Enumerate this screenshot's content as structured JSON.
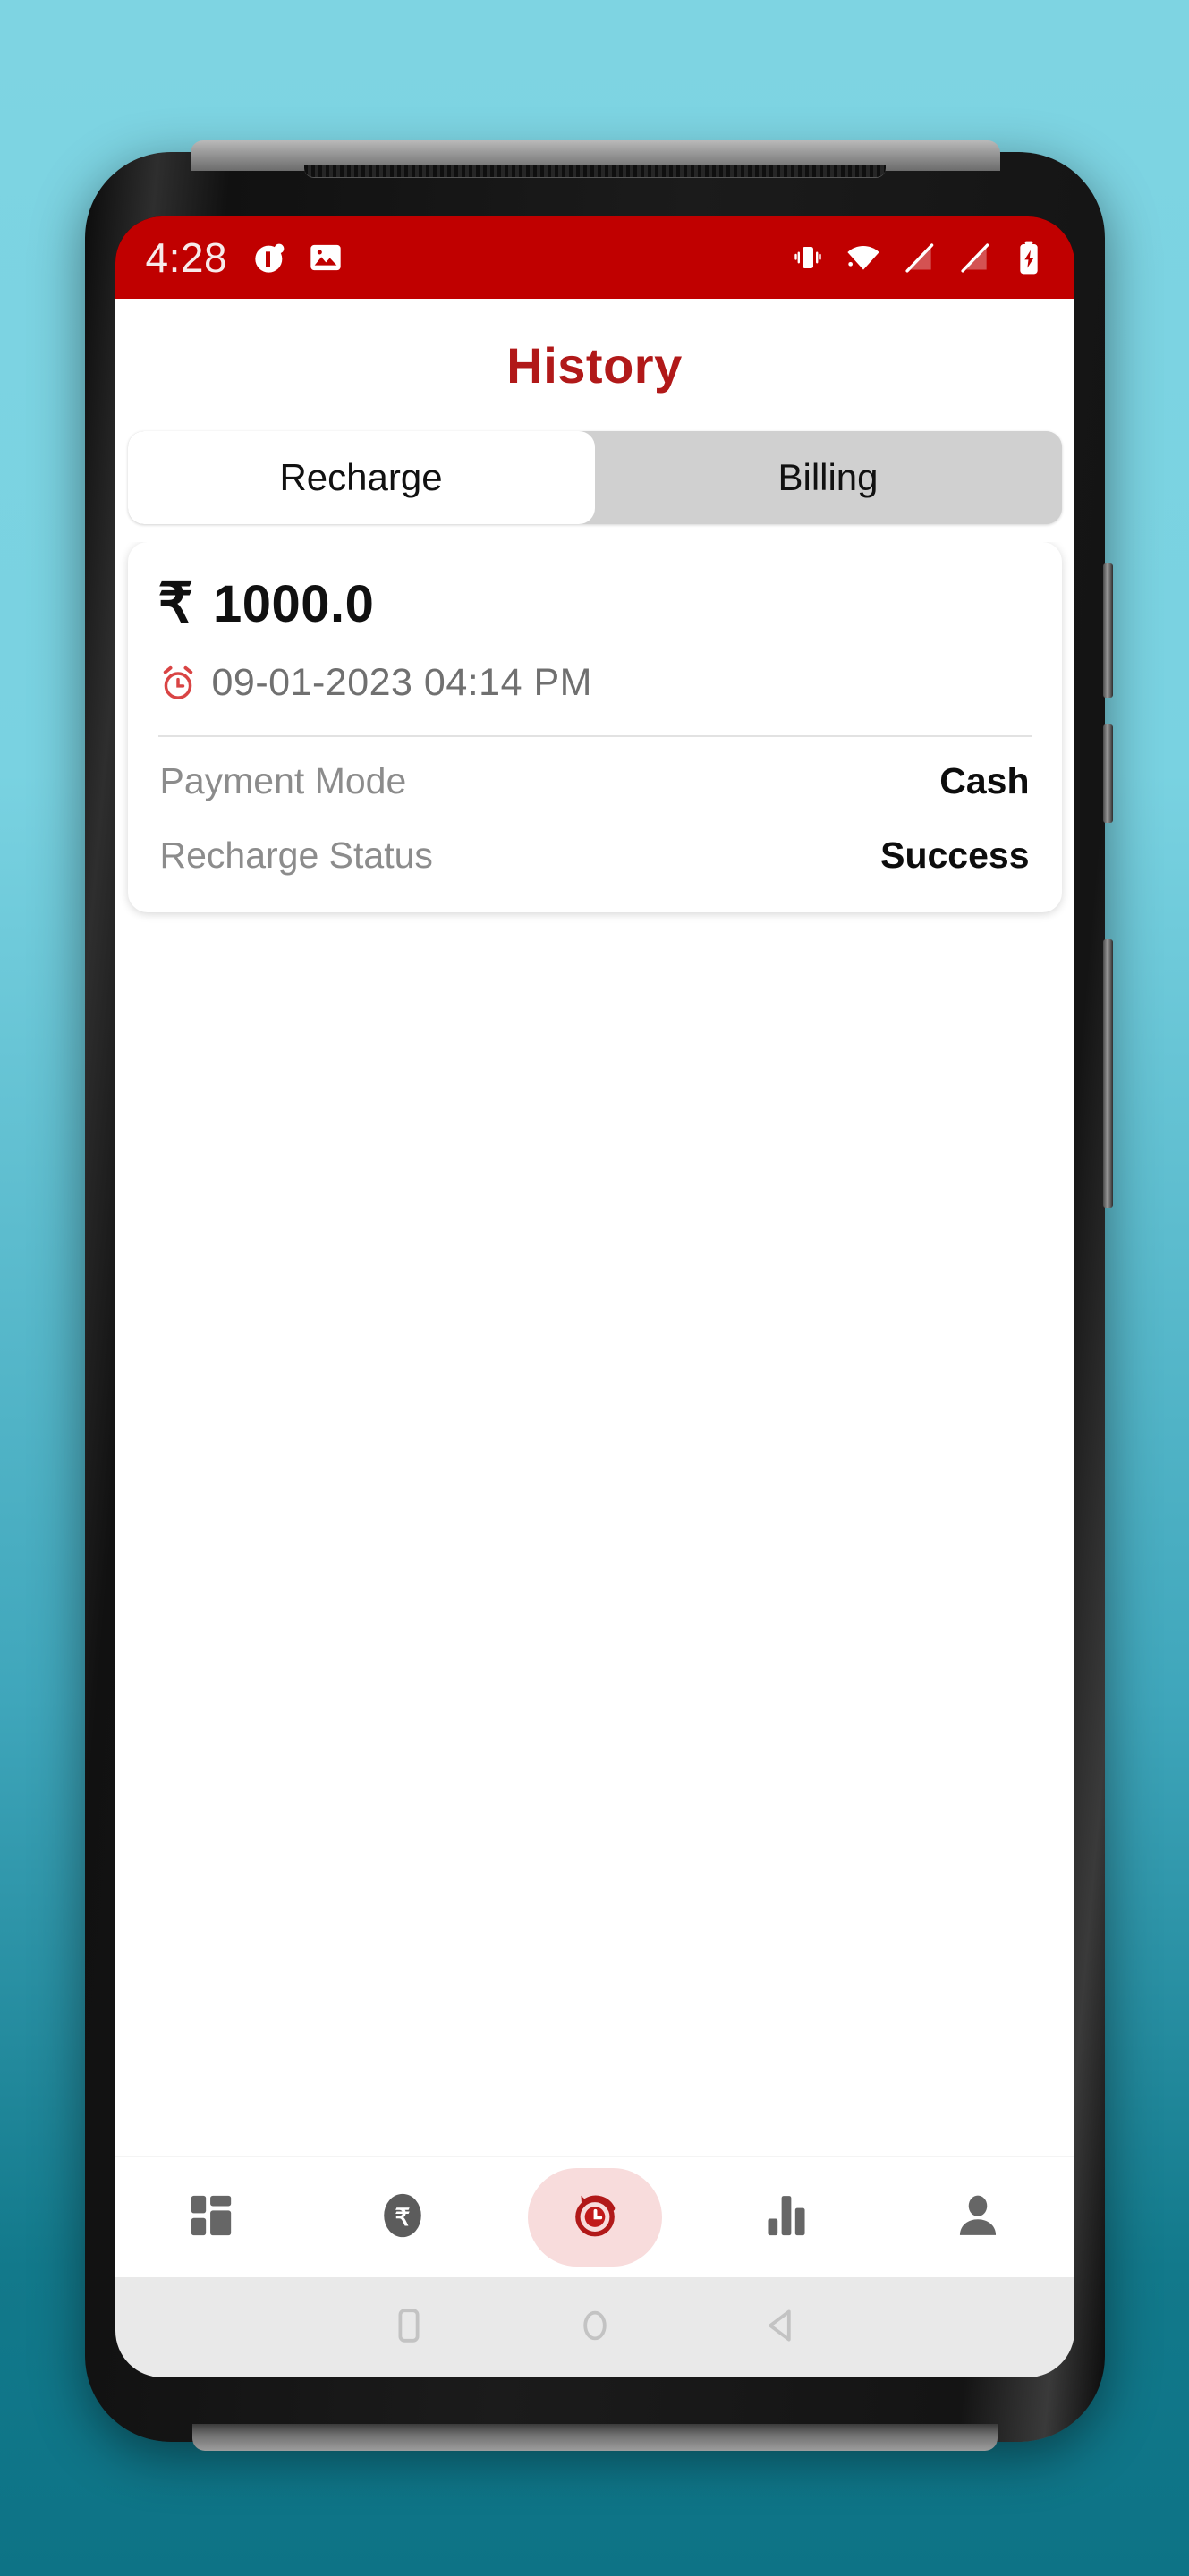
{
  "background": {
    "top_color": "#7ed4e2",
    "bottom_color": "#0d7386"
  },
  "theme": {
    "brand_red": "#c00000",
    "title_red": "#b11919",
    "accent_pill": "#f8dcdc",
    "tab_inactive_bg": "#d0d0d0"
  },
  "status_bar": {
    "time": "4:28",
    "left_icons": [
      "notification-dot-icon",
      "image-icon"
    ],
    "right_icons": [
      "vibrate-icon",
      "wifi-icon",
      "no-signal-1-icon",
      "no-signal-2-icon",
      "battery-charging-icon"
    ]
  },
  "header": {
    "title": "History"
  },
  "tabs": [
    {
      "label": "Recharge",
      "active": true
    },
    {
      "label": "Billing",
      "active": false
    }
  ],
  "history_card": {
    "currency_symbol": "₹",
    "amount": "1000.0",
    "datetime": "09-01-2023 04:14 PM",
    "datetime_icon": "alarm-clock-icon",
    "details": [
      {
        "label": "Payment Mode",
        "value": "Cash"
      },
      {
        "label": "Recharge Status",
        "value": "Success"
      }
    ]
  },
  "bottom_nav": [
    {
      "name": "dashboard",
      "icon": "dashboard-grid-icon",
      "active": false
    },
    {
      "name": "payments",
      "icon": "rupee-coin-icon",
      "active": false
    },
    {
      "name": "history",
      "icon": "history-clock-icon",
      "active": true
    },
    {
      "name": "reports",
      "icon": "bar-chart-icon",
      "active": false
    },
    {
      "name": "profile",
      "icon": "person-icon",
      "active": false
    }
  ],
  "android_nav": [
    {
      "name": "recents",
      "icon": "square-icon"
    },
    {
      "name": "home",
      "icon": "circle-icon"
    },
    {
      "name": "back",
      "icon": "triangle-left-icon"
    }
  ]
}
